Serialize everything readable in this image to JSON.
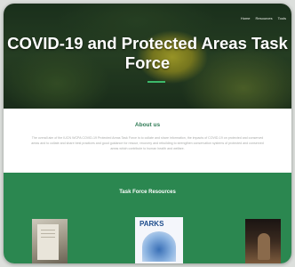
{
  "nav": {
    "items": [
      "Home",
      "Resources",
      "Tools"
    ]
  },
  "hero": {
    "title": "COVID-19 and Protected Areas Task Force"
  },
  "about": {
    "title": "About us",
    "text": "The overall aim of the IUCN WCPA COVID-19 Protected Areas Task Force is to collate and share information, the impacts of COVID-19 on protected and conserved areas and to collate and share best practices and good guidance for rescue, recovery and rebuilding to strengthen conservation systems of protected and conserved areas which contribute to human health and welfare."
  },
  "resources": {
    "title": "Task Force Resources",
    "cards": [
      {
        "name": "resource-card-report"
      },
      {
        "name": "resource-card-parks",
        "label": "PARKS"
      },
      {
        "name": "resource-card-photo"
      }
    ]
  },
  "colors": {
    "brand_green": "#2b8750",
    "accent_green": "#3db86a",
    "about_title": "#2f7a55"
  }
}
